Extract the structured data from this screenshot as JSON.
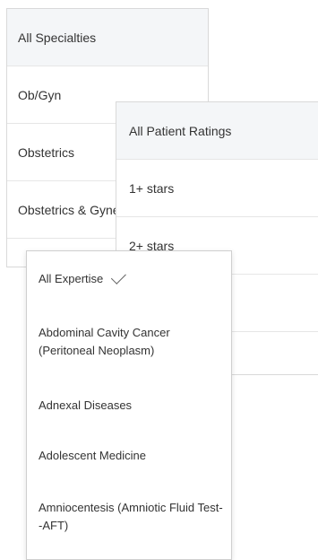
{
  "specialties": {
    "items": [
      "All Specialties",
      "Ob/Gyn",
      "Obstetrics",
      "Obstetrics & Gynecology"
    ]
  },
  "patient_ratings": {
    "items": [
      "All Patient Ratings",
      "1+ stars",
      "2+ stars"
    ]
  },
  "expertise": {
    "selected": "All Expertise",
    "items": [
      "All Expertise",
      "Abdominal Cavity Cancer (Peritoneal Neoplasm)",
      "Adnexal Diseases",
      "Adolescent Medicine",
      "Amniocentesis (Amniotic Fluid Test--AFT)"
    ]
  }
}
